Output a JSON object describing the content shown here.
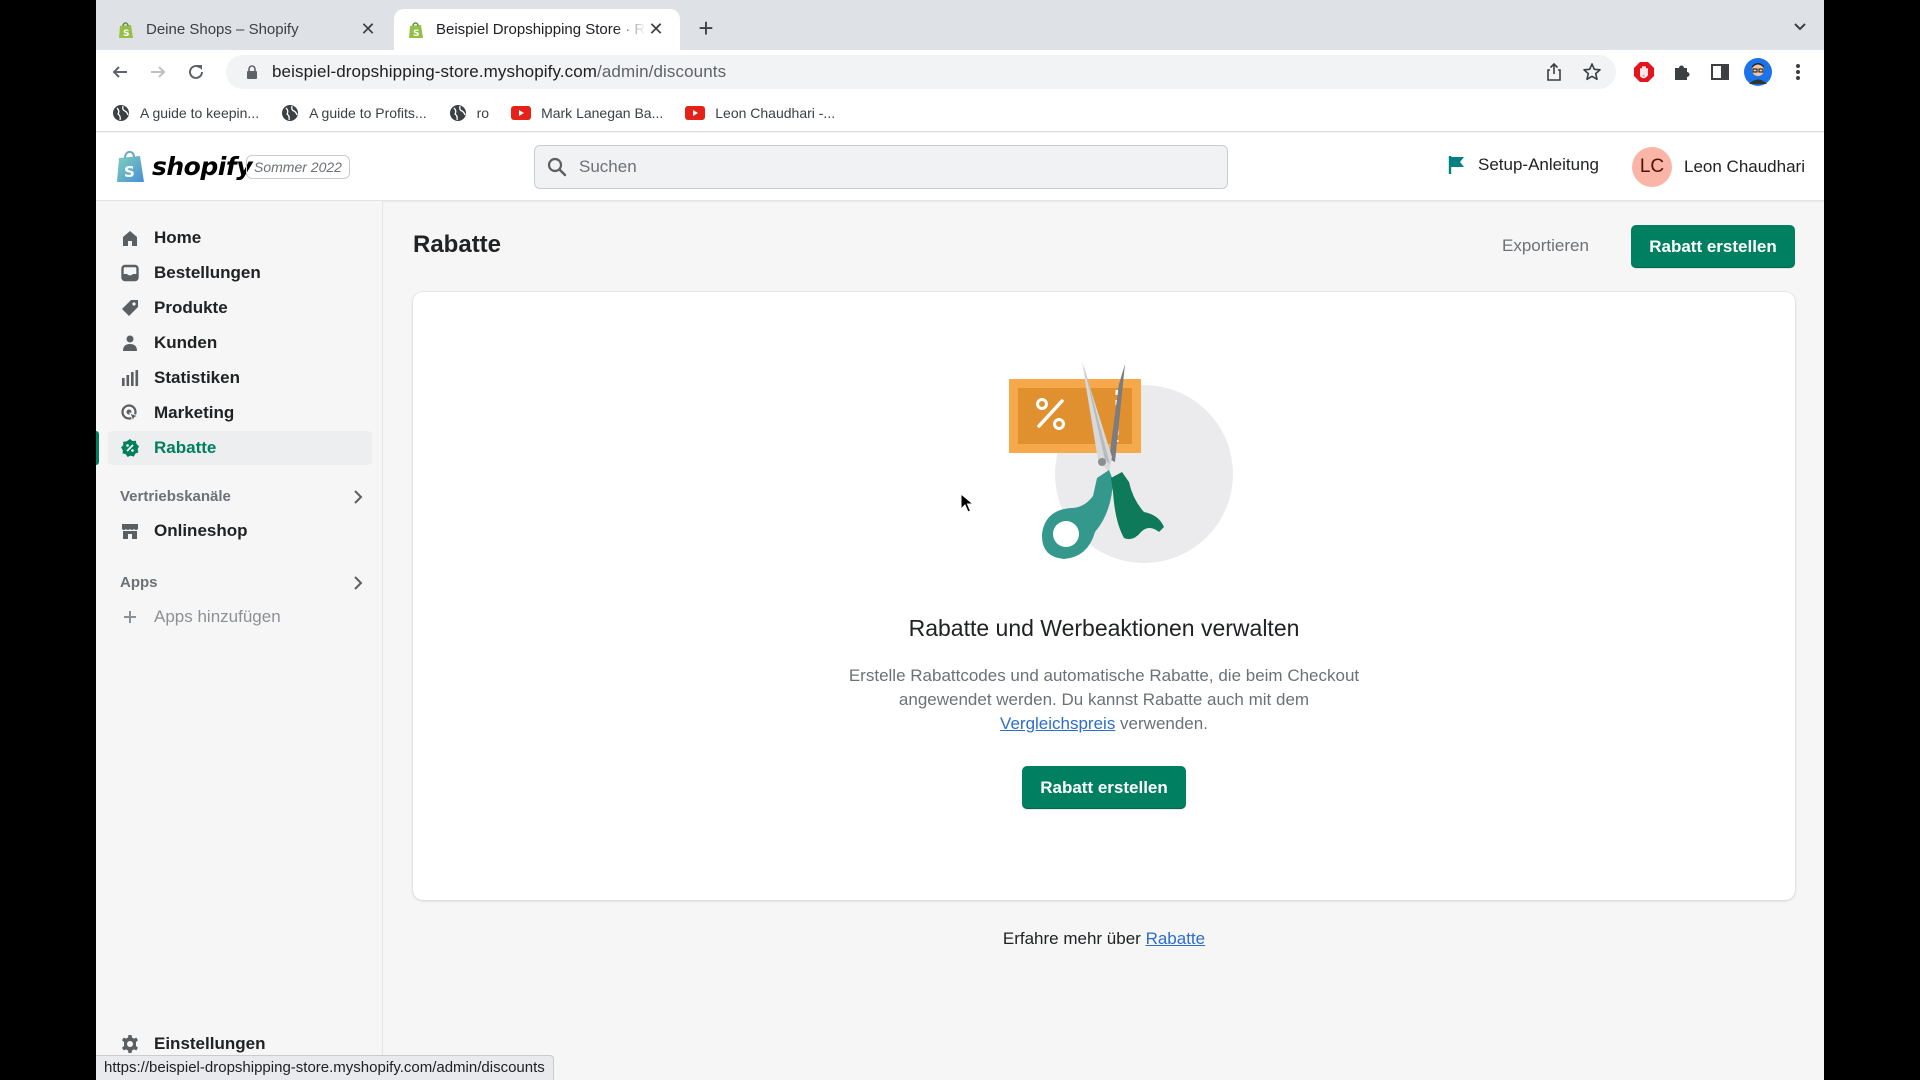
{
  "browser": {
    "tabs": [
      {
        "title": "Deine Shops – Shopify",
        "active": false
      },
      {
        "title": "Beispiel Dropshipping Store · R",
        "active": true
      }
    ],
    "url_host": "beispiel-dropshipping-store.myshopify.com",
    "url_path": "/admin/discounts",
    "bookmarks": [
      {
        "label": "A guide to keepin...",
        "icon": "globe-icon"
      },
      {
        "label": "A guide to Profits...",
        "icon": "globe-icon"
      },
      {
        "label": "ro",
        "icon": "globe-icon"
      },
      {
        "label": "Mark Lanegan Ba...",
        "icon": "youtube-icon"
      },
      {
        "label": "Leon Chaudhari -...",
        "icon": "youtube-icon"
      }
    ],
    "status_url": "https://beispiel-dropshipping-store.myshopify.com/admin/discounts"
  },
  "topbar": {
    "brand": "shopify",
    "edition": "Sommer 2022",
    "search_placeholder": "Suchen",
    "setup_label": "Setup-Anleitung",
    "user_initials": "LC",
    "user_name": "Leon Chaudhari"
  },
  "sidebar": {
    "items": [
      {
        "label": "Home",
        "icon": "home-icon"
      },
      {
        "label": "Bestellungen",
        "icon": "orders-icon"
      },
      {
        "label": "Produkte",
        "icon": "tag-icon"
      },
      {
        "label": "Kunden",
        "icon": "person-icon"
      },
      {
        "label": "Statistiken",
        "icon": "bar-chart-icon"
      },
      {
        "label": "Marketing",
        "icon": "marketing-icon"
      },
      {
        "label": "Rabatte",
        "icon": "discount-icon",
        "selected": true
      }
    ],
    "sales_channels_label": "Vertriebskanäle",
    "online_store_label": "Onlineshop",
    "apps_label": "Apps",
    "add_apps_label": "Apps hinzufügen",
    "settings_label": "Einstellungen"
  },
  "main": {
    "title": "Rabatte",
    "export_label": "Exportieren",
    "create_label": "Rabatt erstellen",
    "empty_state": {
      "heading": "Rabatte und Werbeaktionen verwalten",
      "desc_part1": "Erstelle Rabattcodes und automatische Rabatte, die beim Checkout angewendet werden. Du kannst Rabatte auch mit dem ",
      "desc_link": "Vergleichspreis",
      "desc_part2": " verwenden.",
      "button_label": "Rabatt erstellen"
    },
    "learn_more_prefix": "Erfahre mehr über ",
    "learn_more_link": "Rabatte"
  },
  "colors": {
    "primary": "#008060",
    "link": "#2c6ecb",
    "avatar_bg": "#fbb5a6"
  }
}
